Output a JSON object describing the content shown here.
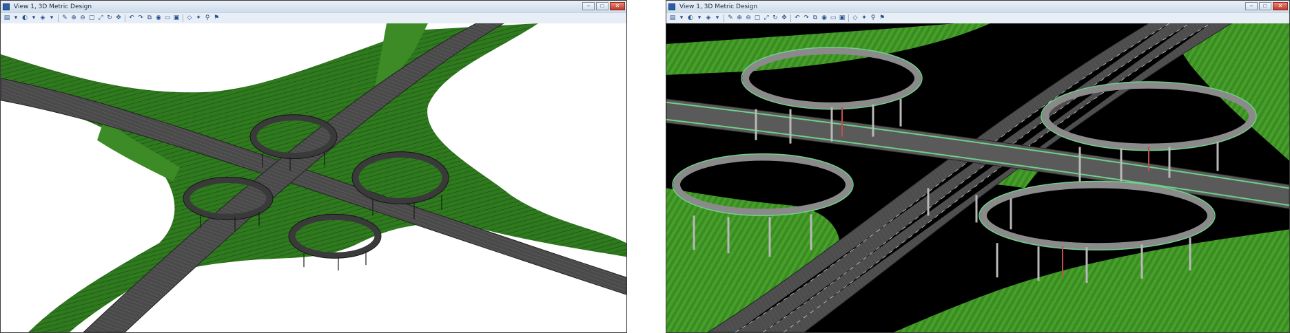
{
  "windows": [
    {
      "id": "a",
      "title": "View 1, 3D Metric Design",
      "background": "#ffffff",
      "controls": {
        "minimize": "‒",
        "maximize": "□",
        "close": "✕"
      }
    },
    {
      "id": "b",
      "title": "View 1, 3D Metric Design",
      "background": "#000000",
      "controls": {
        "minimize": "‒",
        "maximize": "□",
        "close": "✕"
      }
    }
  ],
  "toolbar_icons": [
    "view-attributes-icon",
    "dropdown-icon",
    "display-style-icon",
    "dropdown-icon",
    "clip-volume-icon",
    "dropdown-icon",
    "update-view-icon",
    "zoom-in-icon",
    "zoom-out-icon",
    "window-area-icon",
    "fit-view-icon",
    "rotate-view-icon",
    "pan-view-icon",
    "view-previous-icon",
    "view-next-icon",
    "copy-view-icon",
    "camera-icon",
    "front-view-icon",
    "top-view-icon",
    "iso-view-icon",
    "render-icon",
    "walk-icon",
    "fly-icon"
  ],
  "colors": {
    "terrain": "#2f7a1e",
    "terrain_dark": "#1c4f12",
    "road": "#4a4a4a",
    "road_edge": "#2a2a2a",
    "pier": "#b9b9b9",
    "rail_green": "#6fd08a",
    "rail_red": "#c0504d"
  }
}
